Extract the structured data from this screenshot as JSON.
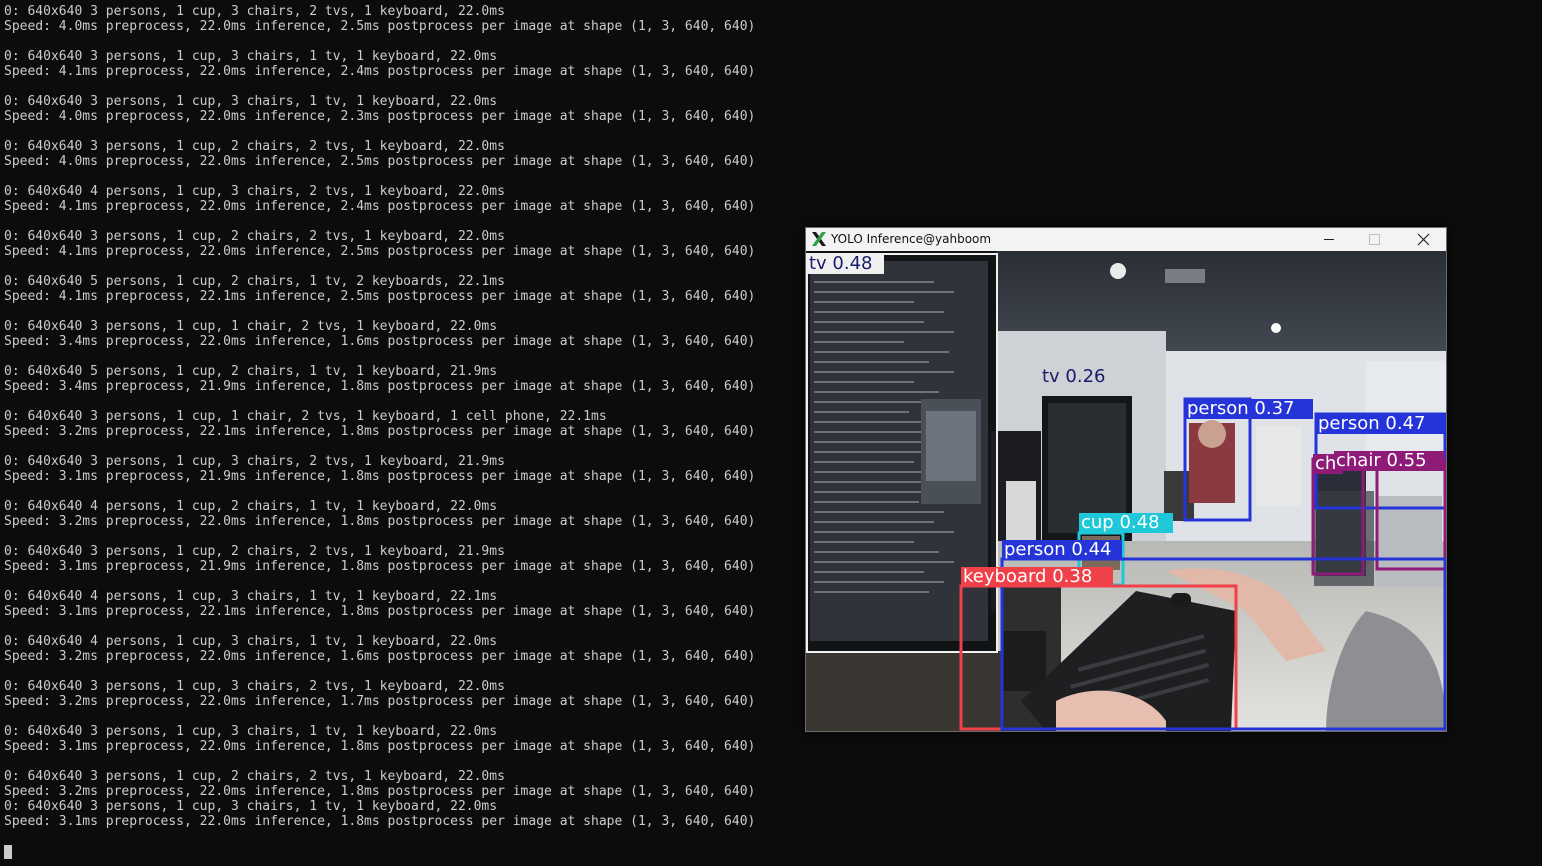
{
  "terminal": {
    "lines": [
      "0: 640x640 3 persons, 1 cup, 3 chairs, 2 tvs, 1 keyboard, 22.0ms",
      "Speed: 4.0ms preprocess, 22.0ms inference, 2.5ms postprocess per image at shape (1, 3, 640, 640)",
      "",
      "0: 640x640 3 persons, 1 cup, 3 chairs, 1 tv, 1 keyboard, 22.0ms",
      "Speed: 4.1ms preprocess, 22.0ms inference, 2.4ms postprocess per image at shape (1, 3, 640, 640)",
      "",
      "0: 640x640 3 persons, 1 cup, 3 chairs, 1 tv, 1 keyboard, 22.0ms",
      "Speed: 4.0ms preprocess, 22.0ms inference, 2.3ms postprocess per image at shape (1, 3, 640, 640)",
      "",
      "0: 640x640 3 persons, 1 cup, 2 chairs, 2 tvs, 1 keyboard, 22.0ms",
      "Speed: 4.0ms preprocess, 22.0ms inference, 2.5ms postprocess per image at shape (1, 3, 640, 640)",
      "",
      "0: 640x640 4 persons, 1 cup, 3 chairs, 2 tvs, 1 keyboard, 22.0ms",
      "Speed: 4.1ms preprocess, 22.0ms inference, 2.4ms postprocess per image at shape (1, 3, 640, 640)",
      "",
      "0: 640x640 3 persons, 1 cup, 2 chairs, 2 tvs, 1 keyboard, 22.0ms",
      "Speed: 4.1ms preprocess, 22.0ms inference, 2.5ms postprocess per image at shape (1, 3, 640, 640)",
      "",
      "0: 640x640 5 persons, 1 cup, 2 chairs, 1 tv, 2 keyboards, 22.1ms",
      "Speed: 4.1ms preprocess, 22.1ms inference, 2.5ms postprocess per image at shape (1, 3, 640, 640)",
      "",
      "0: 640x640 3 persons, 1 cup, 1 chair, 2 tvs, 1 keyboard, 22.0ms",
      "Speed: 3.4ms preprocess, 22.0ms inference, 1.6ms postprocess per image at shape (1, 3, 640, 640)",
      "",
      "0: 640x640 5 persons, 1 cup, 2 chairs, 1 tv, 1 keyboard, 21.9ms",
      "Speed: 3.4ms preprocess, 21.9ms inference, 1.8ms postprocess per image at shape (1, 3, 640, 640)",
      "",
      "0: 640x640 3 persons, 1 cup, 1 chair, 2 tvs, 1 keyboard, 1 cell phone, 22.1ms",
      "Speed: 3.2ms preprocess, 22.1ms inference, 1.8ms postprocess per image at shape (1, 3, 640, 640)",
      "",
      "0: 640x640 3 persons, 1 cup, 3 chairs, 2 tvs, 1 keyboard, 21.9ms",
      "Speed: 3.1ms preprocess, 21.9ms inference, 1.8ms postprocess per image at shape (1, 3, 640, 640)",
      "",
      "0: 640x640 4 persons, 1 cup, 2 chairs, 1 tv, 1 keyboard, 22.0ms",
      "Speed: 3.2ms preprocess, 22.0ms inference, 1.8ms postprocess per image at shape (1, 3, 640, 640)",
      "",
      "0: 640x640 3 persons, 1 cup, 2 chairs, 2 tvs, 1 keyboard, 21.9ms",
      "Speed: 3.1ms preprocess, 21.9ms inference, 1.8ms postprocess per image at shape (1, 3, 640, 640)",
      "",
      "0: 640x640 4 persons, 1 cup, 3 chairs, 1 tv, 1 keyboard, 22.1ms",
      "Speed: 3.1ms preprocess, 22.1ms inference, 1.8ms postprocess per image at shape (1, 3, 640, 640)",
      "",
      "0: 640x640 4 persons, 1 cup, 3 chairs, 1 tv, 1 keyboard, 22.0ms",
      "Speed: 3.2ms preprocess, 22.0ms inference, 1.6ms postprocess per image at shape (1, 3, 640, 640)",
      "",
      "0: 640x640 3 persons, 1 cup, 3 chairs, 2 tvs, 1 keyboard, 22.0ms",
      "Speed: 3.2ms preprocess, 22.0ms inference, 1.7ms postprocess per image at shape (1, 3, 640, 640)",
      "",
      "0: 640x640 3 persons, 1 cup, 3 chairs, 1 tv, 1 keyboard, 22.0ms",
      "Speed: 3.1ms preprocess, 22.0ms inference, 1.8ms postprocess per image at shape (1, 3, 640, 640)",
      "",
      "0: 640x640 3 persons, 1 cup, 2 chairs, 2 tvs, 1 keyboard, 22.0ms",
      "Speed: 3.2ms preprocess, 22.0ms inference, 1.8ms postprocess per image at shape (1, 3, 640, 640)",
      "0: 640x640 3 persons, 1 cup, 3 chairs, 1 tv, 1 keyboard, 22.0ms",
      "Speed: 3.1ms preprocess, 22.0ms inference, 1.8ms postprocess per image at shape (1, 3, 640, 640)"
    ]
  },
  "yolo_window": {
    "title": "YOLO Inference@yahboom",
    "controls": [
      "minimize-icon",
      "maximize-icon",
      "close-icon"
    ],
    "detections": [
      {
        "label": "tv 0.48",
        "class": "tv",
        "confidence": 0.48,
        "color": "#f0f0f0",
        "text_color": "#1a1a6a"
      },
      {
        "label": "tv 0.26",
        "class": "tv",
        "confidence": 0.26,
        "color": "#f0f0f0",
        "text_color": "#1a1a6a"
      },
      {
        "label": "person 0.37",
        "class": "person",
        "confidence": 0.37,
        "color": "#2434d8",
        "text_color": "#ffffff"
      },
      {
        "label": "person 0.47",
        "class": "person",
        "confidence": 0.47,
        "color": "#2434d8",
        "text_color": "#ffffff"
      },
      {
        "label": "person 0.44",
        "class": "person",
        "confidence": 0.44,
        "color": "#2434d8",
        "text_color": "#ffffff"
      },
      {
        "label": "chair 0.55",
        "class": "chair",
        "confidence": 0.55,
        "color": "#8e1b78",
        "text_color": "#ffffff"
      },
      {
        "label": "ch",
        "class": "chair",
        "confidence": null,
        "color": "#8e1b78",
        "text_color": "#ffffff"
      },
      {
        "label": "cup 0.48",
        "class": "cup",
        "confidence": 0.48,
        "color": "#1ec8d8",
        "text_color": "#ffffff"
      },
      {
        "label": "keyboard 0.38",
        "class": "keyboard",
        "confidence": 0.38,
        "color": "#f0404a",
        "text_color": "#ffffff"
      }
    ]
  }
}
